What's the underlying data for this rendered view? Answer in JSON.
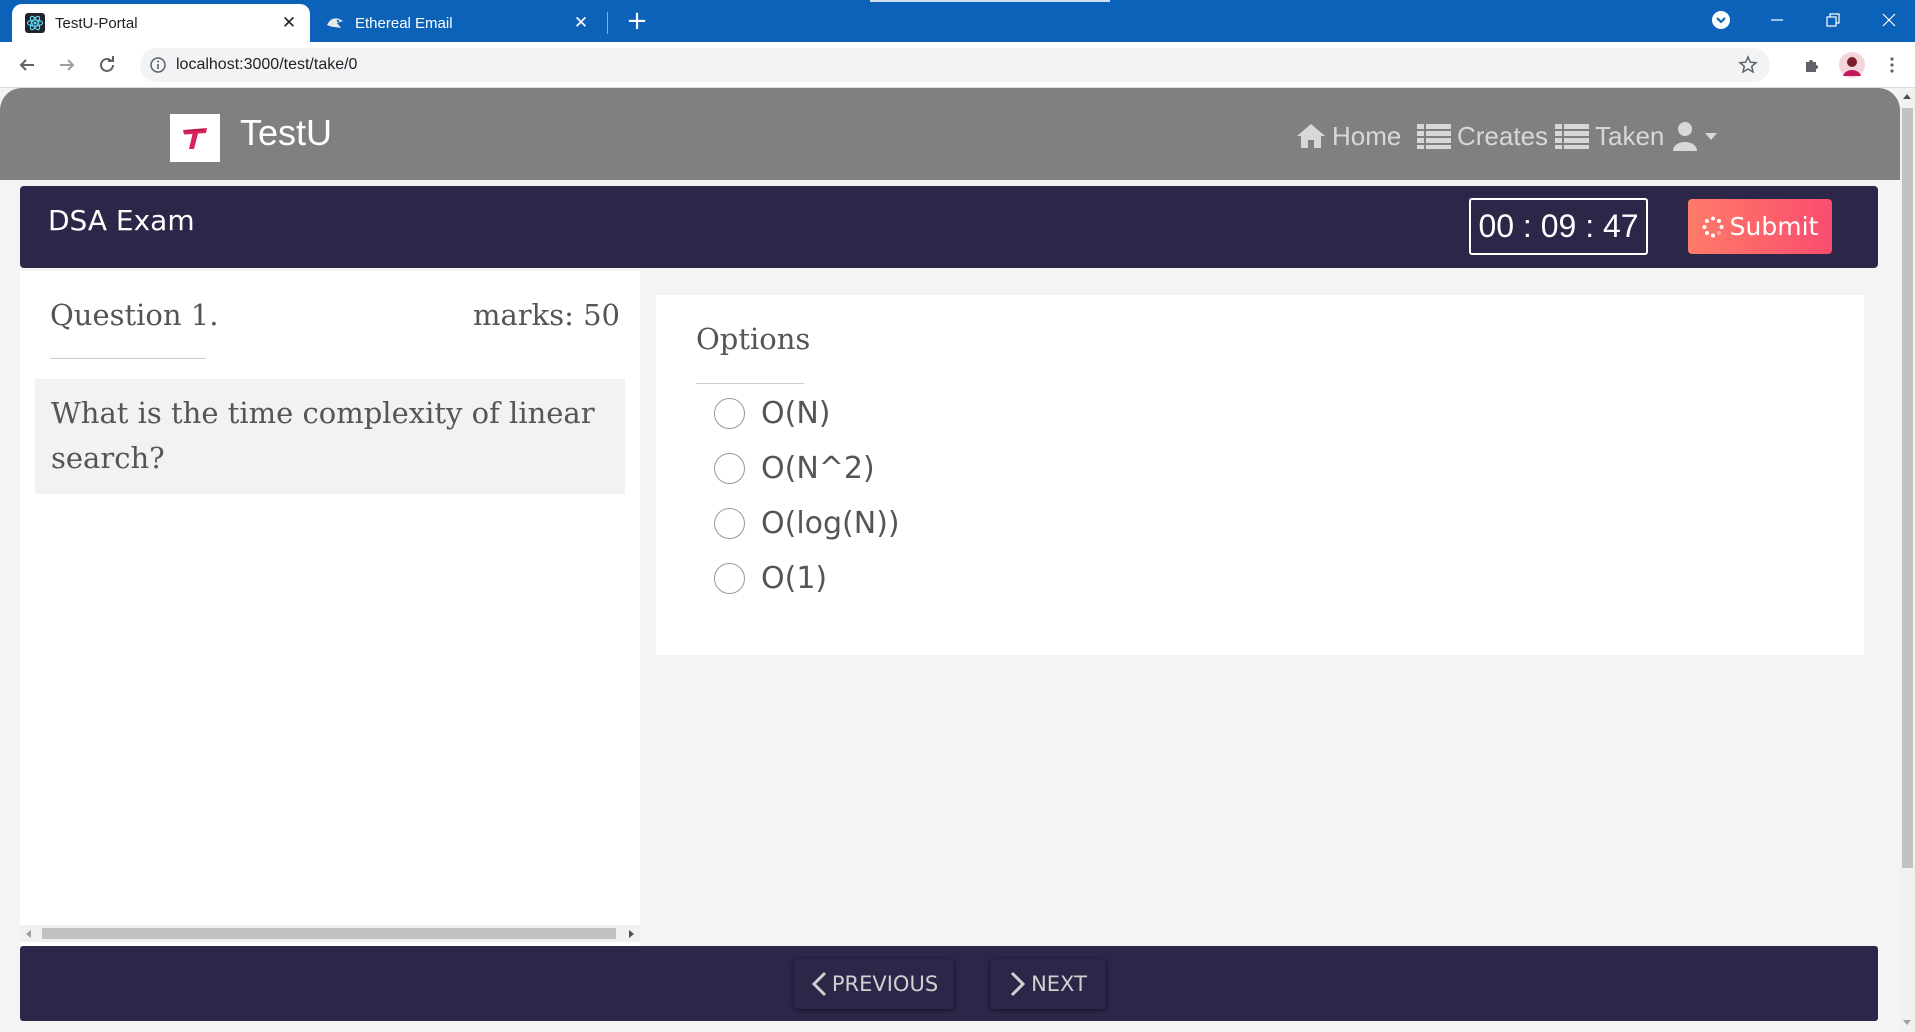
{
  "browser": {
    "tabs": [
      {
        "title": "TestU-Portal",
        "active": true
      },
      {
        "title": "Ethereal Email",
        "active": false
      }
    ],
    "url": "localhost:3000/test/take/0"
  },
  "nav": {
    "brand": "TestU",
    "links": [
      "Home",
      "Creates",
      "Taken"
    ]
  },
  "exam": {
    "title": "DSA Exam",
    "timer": "00 : 09 : 47",
    "submit_label": "Submit"
  },
  "question": {
    "label": "Question 1.",
    "marks": "marks: 50",
    "text": "What is the time complexity of linear search?"
  },
  "options": {
    "label": "Options",
    "items": [
      "O(N)",
      "O(N^2)",
      "O(log(N))",
      "O(1)"
    ]
  },
  "footer": {
    "previous_label": "PREVIOUS",
    "next_label": "NEXT"
  },
  "colors": {
    "chrome_blue": "#0b62b8",
    "nav_gray": "#808080",
    "header_navy": "#2c2649",
    "submit_gradient_start": "#fe7b68",
    "submit_gradient_end": "#fa4d6f",
    "brand_logo_red": "#d6245b"
  }
}
